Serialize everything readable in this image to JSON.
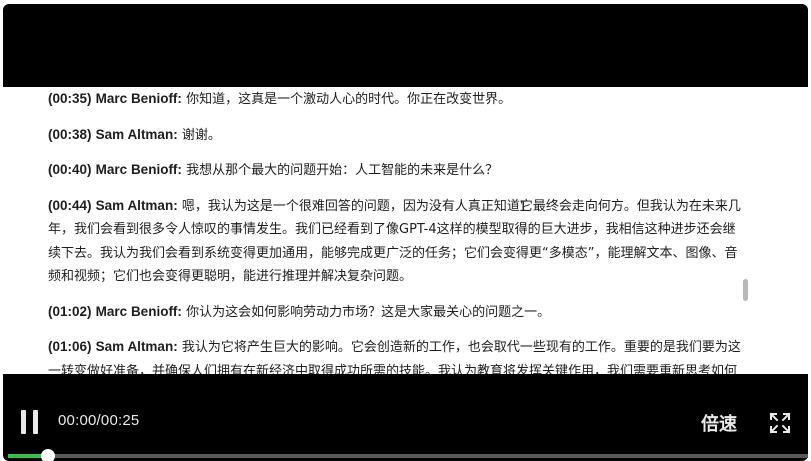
{
  "transcript": {
    "entries": [
      {
        "time": "(00:35)",
        "speaker": "Marc Benioff:",
        "text": "你知道，这真是一个激动人心的时代。你正在改变世界。"
      },
      {
        "time": "(00:38)",
        "speaker": "Sam Altman:",
        "text": "谢谢。"
      },
      {
        "time": "(00:40)",
        "speaker": "Marc Benioff:",
        "text": "我想从那个最大的问题开始：人工智能的未来是什么？"
      },
      {
        "time": "(00:44)",
        "speaker": "Sam Altman:",
        "text": "嗯，我认为这是一个很难回答的问题，因为没有人真正知道它最终会走向何方。但我认为在未来几年，我们会看到很多令人惊叹的事情发生。我们已经看到了像GPT-4这样的模型取得的巨大进步，我相信这种进步还会继续下去。我认为我们会看到系统变得更加通用，能够完成更广泛的任务；它们会变得更“多模态”，能理解文本、图像、音频和视频；它们也会变得更聪明，能进行推理并解决复杂问题。"
      },
      {
        "time": "(01:02)",
        "speaker": "Marc Benioff:",
        "text": "你认为这会如何影响劳动力市场？这是大家最关心的问题之一。"
      },
      {
        "time": "(01:06)",
        "speaker": "Sam Altman:",
        "text": "我认为它将产生巨大的影响。它会创造新的工作，也会取代一些现有的工作。重要的是我们要为这一转变做好准备，并确保人们拥有在新经济中取得成功所需的技能。我认为教育将发挥关键作用，我们需要重新思考如何教"
      }
    ]
  },
  "player": {
    "time_display": "00:00/00:25",
    "speed_label": "倍速",
    "progress_fraction": 0.05,
    "accent_color": "#36c24a",
    "icons": [
      "pause-icon",
      "fullscreen-icon"
    ]
  }
}
